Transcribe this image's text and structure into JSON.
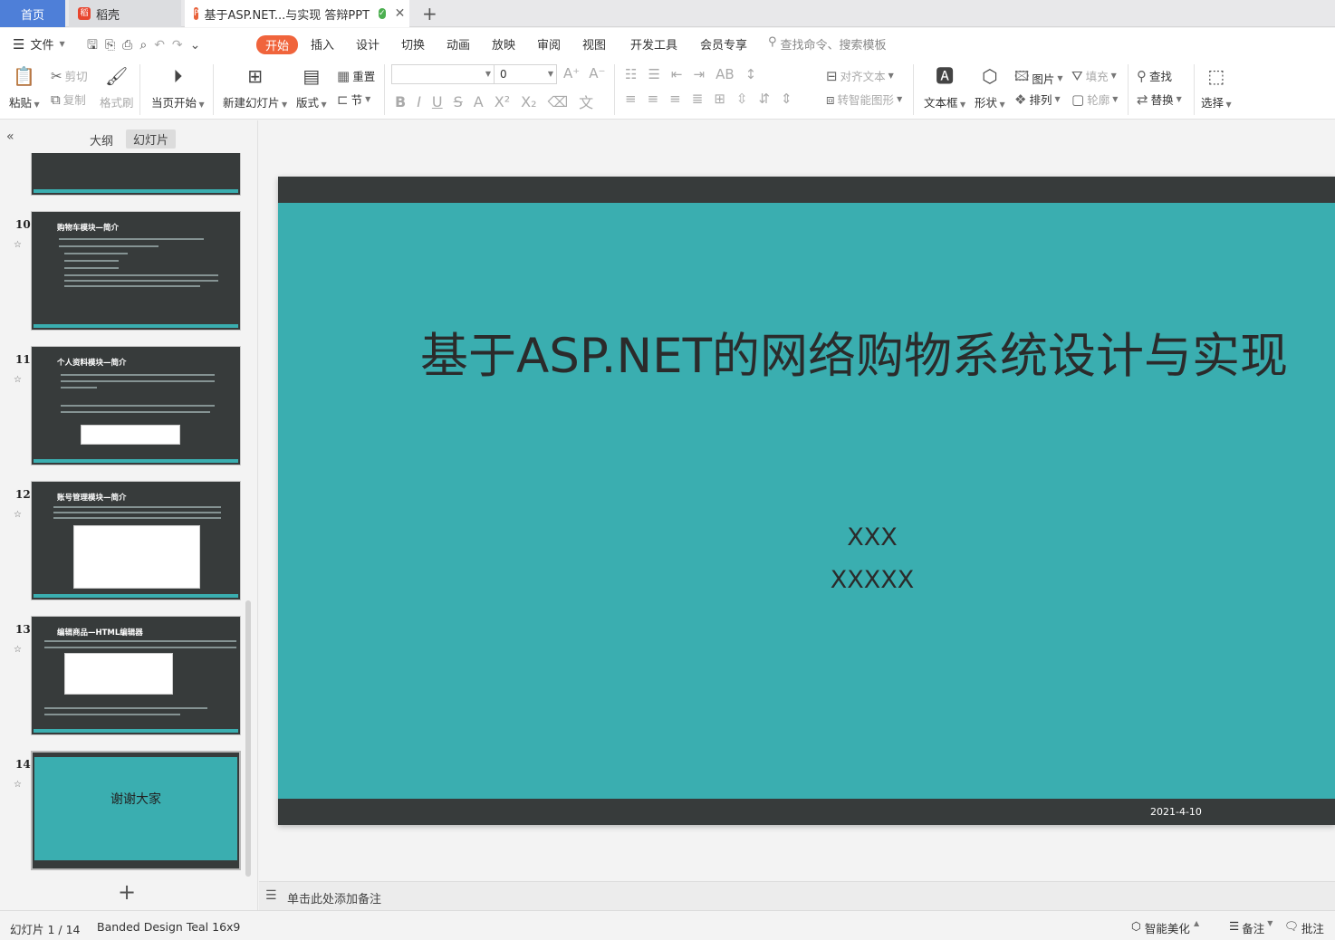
{
  "tabs": {
    "home": "首页",
    "daoke": "稻壳",
    "doc": "基于ASP.NET...与实现 答辩PPT",
    "new_tab": "+"
  },
  "menu": {
    "file": "文件",
    "items": [
      "开始",
      "插入",
      "设计",
      "切换",
      "动画",
      "放映",
      "审阅",
      "视图",
      "开发工具",
      "会员专享"
    ],
    "search_placeholder": "查找命令、搜索模板"
  },
  "ribbon": {
    "paste": "粘贴",
    "cut": "剪切",
    "copy": "复制",
    "format_painter": "格式刷",
    "play_from_current": "当页开始",
    "new_slide": "新建幻灯片",
    "layout": "版式",
    "reset": "重置",
    "section": "节",
    "font_name": "",
    "font_size": "0",
    "align_text": "对齐文本",
    "smart_graphic": "转智能图形",
    "textbox": "文本框",
    "shape": "形状",
    "picture": "图片",
    "arrange": "排列",
    "fill": "填充",
    "outline": "轮廓",
    "find": "查找",
    "replace": "替换",
    "select": "选择"
  },
  "left_panel": {
    "tab_outline": "大纲",
    "tab_slides": "幻灯片",
    "add_slide": "+",
    "slides": [
      {
        "num": "10",
        "title": "购物车模块—简介"
      },
      {
        "num": "11",
        "title": "个人资料模块—简介"
      },
      {
        "num": "12",
        "title": "账号管理模块—简介"
      },
      {
        "num": "13",
        "title": "编辑商品—HTML编辑器"
      },
      {
        "num": "14",
        "title": "谢谢大家"
      }
    ]
  },
  "slide": {
    "title": "基于ASP.NET的网络购物系统设计与实现",
    "author": "XXX",
    "advisor": "XXXXX",
    "date": "2021-4-10",
    "colors": {
      "teal": "#3aaeb0",
      "dark": "#373b3b"
    }
  },
  "notes_placeholder": "单击此处添加备注",
  "status": {
    "slide_counter": "幻灯片 1 / 14",
    "theme": "Banded Design Teal 16x9",
    "smart_beautify": "智能美化",
    "notes": "备注",
    "comments": "批注"
  }
}
